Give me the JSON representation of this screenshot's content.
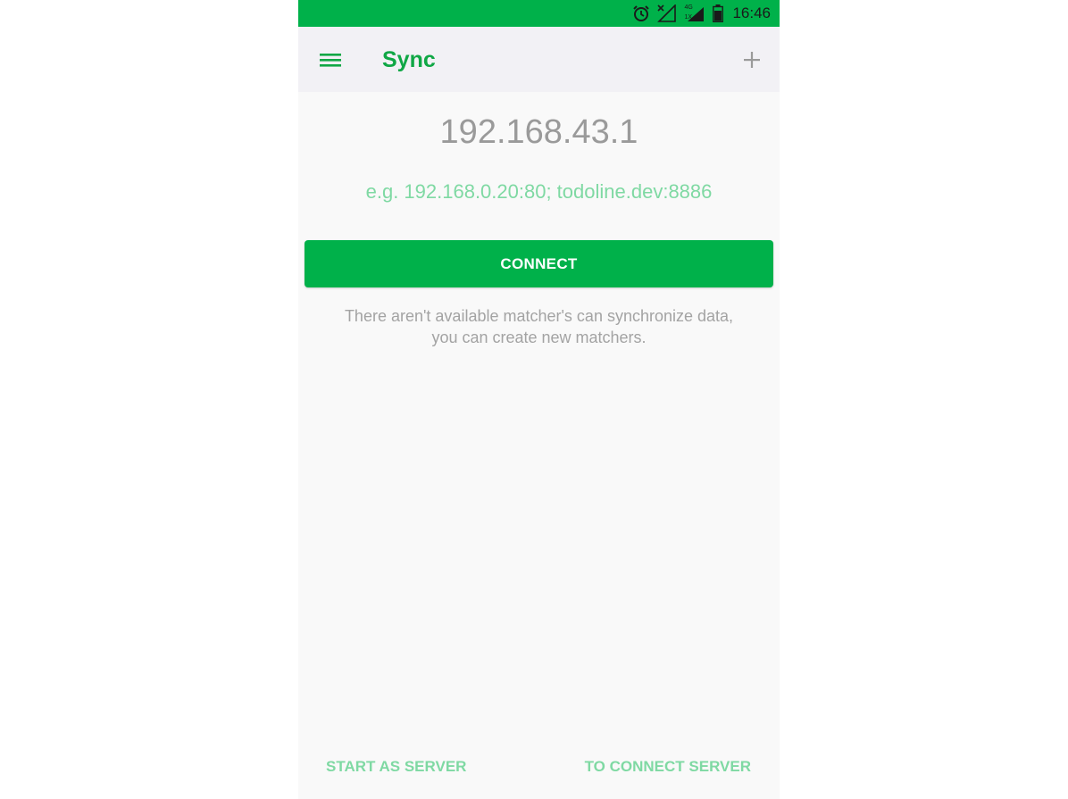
{
  "status_bar": {
    "time": "16:46",
    "icons": [
      "alarm-icon",
      "no-signal-icon",
      "4g-signal-icon",
      "battery-icon"
    ],
    "network_label_top": "4G",
    "network_label_bottom": "1X",
    "background_color": "#00b14a"
  },
  "app_bar": {
    "title": "Sync",
    "menu_icon": "hamburger-menu-icon",
    "add_icon": "plus-icon",
    "accent_color": "#10a745"
  },
  "main": {
    "address_value": "192.168.43.1",
    "hint": "e.g. 192.168.0.20:80; todoline.dev:8886",
    "connect_label": "CONNECT",
    "empty_message_line1": "There aren't available matcher's can synchronize data,",
    "empty_message_line2": "you can create new matchers."
  },
  "bottom_actions": {
    "start_server_label": "START AS SERVER",
    "to_connect_label": "TO CONNECT SERVER"
  }
}
